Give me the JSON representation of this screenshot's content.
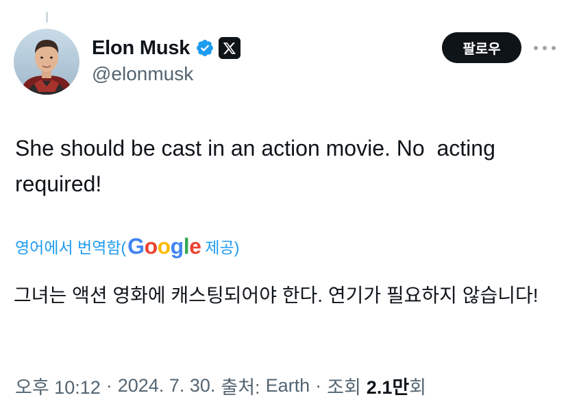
{
  "author": {
    "display_name": "Elon Musk",
    "handle": "@elonmusk",
    "avatar_icon": "profile-photo",
    "verified_icon": "verified-badge-icon",
    "affiliate_icon": "x-logo-icon"
  },
  "actions": {
    "follow_label": "팔로우",
    "more_icon": "more-options-icon"
  },
  "tweet": {
    "text": "She should be cast in an action movie. No  acting required!",
    "translate_label": "영어에서 번역함(",
    "translate_provider": "Google",
    "translate_suffix": "제공)",
    "translated_text": "그녀는 액션 영화에 캐스팅되어야 한다. 연기가 필요하지 않습니다!"
  },
  "meta": {
    "time": "오후 10:12",
    "separator": "·",
    "date": "2024. 7. 30.",
    "source_label": "출처:",
    "source": "Earth",
    "views_label": "조회",
    "views_value": "2.1만",
    "views_suffix": "회"
  },
  "colors": {
    "accent": "#1d9bf0",
    "text_primary": "#0f1419",
    "text_secondary": "#536471",
    "verified": "#1d9bf0"
  }
}
